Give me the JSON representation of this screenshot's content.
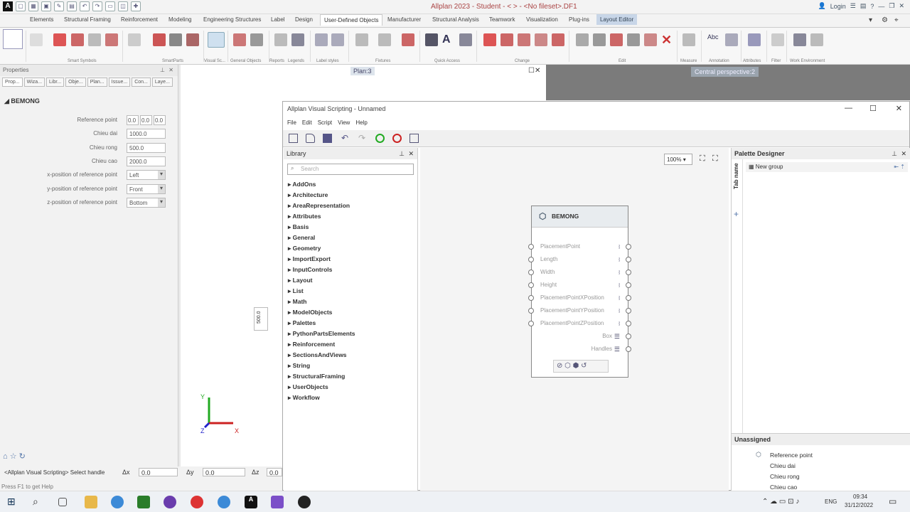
{
  "app": {
    "title": "Allplan 2023 - Student - <      > - <No fileset>.DF1",
    "login": "Login"
  },
  "tabs": [
    "Elements",
    "Structural Framing",
    "Reinforcement",
    "Modeling",
    "Engineering Structures",
    "Label",
    "Design",
    "User-Defined Objects",
    "Manufacturer",
    "Structural Analysis",
    "Teamwork",
    "Visualization",
    "Plug-ins",
    "Layout Editor"
  ],
  "ribbon_groups": [
    "Smart Symbols",
    "SmartParts",
    "Visual Sc...",
    "General Objects",
    "Reports",
    "Legends",
    "Label styles",
    "Fixtures",
    "Quick Access",
    "Change",
    "Edit",
    "Measure",
    "Annotation",
    "Attributes",
    "Filter",
    "Work Environment"
  ],
  "properties": {
    "title": "Properties",
    "tabs": [
      "Prop...",
      "Wiza...",
      "Libr...",
      "Obje...",
      "Plan...",
      "Issue...",
      "Con...",
      "Laye..."
    ],
    "section": "BEMONG",
    "rows": [
      {
        "label": "Reference point",
        "value": "0.0"
      },
      {
        "label": "Chieu dai",
        "value": "1000.0"
      },
      {
        "label": "Chieu rong",
        "value": "500.0"
      },
      {
        "label": "Chieu cao",
        "value": "2000.0"
      },
      {
        "label": "x-position of reference point",
        "value": "Left"
      },
      {
        "label": "y-position of reference point",
        "value": "Front"
      },
      {
        "label": "z-position of reference point",
        "value": "Bottom"
      }
    ]
  },
  "views": {
    "plan": "Plan:3",
    "perspective": "Central perspective:2",
    "dim": "500.0"
  },
  "status": {
    "prompt": "<Allplan Visual Scripting> Select handle",
    "dx_label": "Δx",
    "dx": "0.0",
    "dy_label": "Δy",
    "dy": "0.0",
    "dz_label": "Δz",
    "dz": "0.0",
    "help": "Press F1 to get Help"
  },
  "vs": {
    "title": "Allplan Visual Scripting - Unnamed",
    "menu": [
      "File",
      "Edit",
      "Script",
      "View",
      "Help"
    ],
    "library": {
      "title": "Library",
      "search": "Search",
      "items": [
        "AddOns",
        "Architecture",
        "AreaRepresentation",
        "Attributes",
        "Basis",
        "General",
        "Geometry",
        "ImportExport",
        "InputControls",
        "Layout",
        "List",
        "Math",
        "ModelObjects",
        "Palettes",
        "PythonPartsElements",
        "Reinforcement",
        "SectionsAndViews",
        "String",
        "StructuralFraming",
        "UserObjects",
        "Workflow"
      ]
    },
    "zoom": "100%",
    "node": {
      "title": "BEMONG",
      "inputs": [
        "PlacementPoint",
        "Length",
        "Width",
        "Height",
        "PlacementPointXPosition",
        "PlacementPointYPosition",
        "PlacementPointZPosition"
      ],
      "outputs": [
        "Box",
        "Handles"
      ]
    },
    "palette": {
      "title": "Palette Designer",
      "group": "New group",
      "tabname": "Tab name",
      "unassigned": "Unassigned",
      "items": [
        "Reference point",
        "Chieu dai",
        "Chieu rong",
        "Chieu cao"
      ]
    }
  },
  "taskbar": {
    "lang": "ENG",
    "time": "09:34",
    "date": "31/12/2022"
  }
}
